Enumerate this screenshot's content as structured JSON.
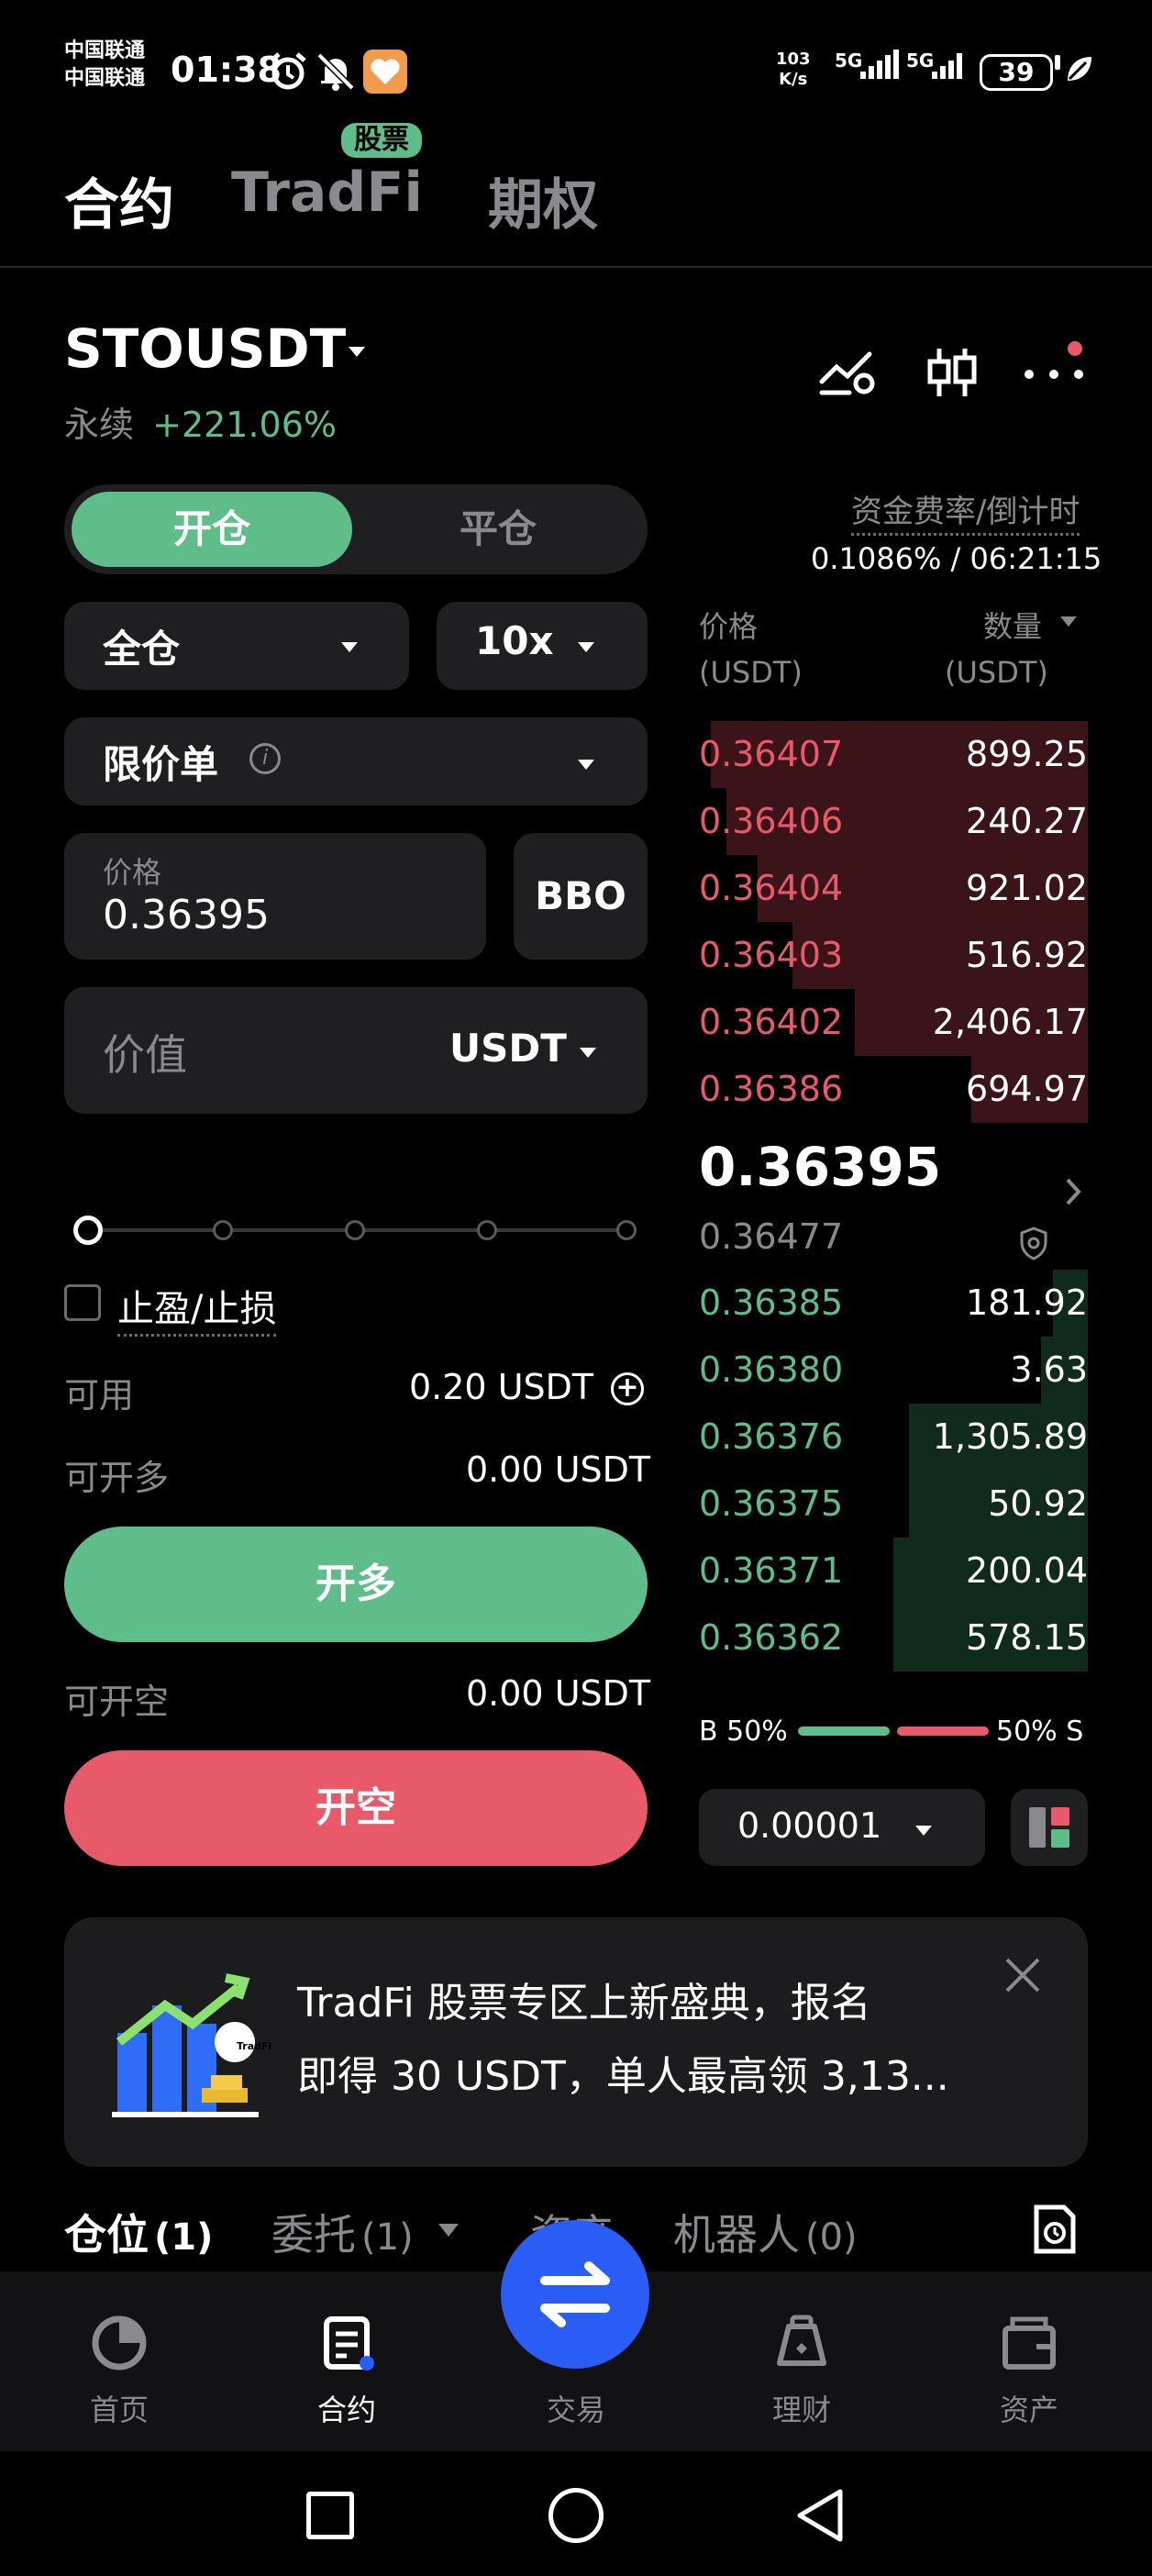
{
  "status_bar": {
    "carrier_line1": "中国联通",
    "carrier_line2": "中国联通",
    "time": "01:38",
    "net_speed_value": "103",
    "net_speed_unit": "K/s",
    "signal1": "5G",
    "signal2": "5G",
    "battery": "39"
  },
  "top_tabs": [
    {
      "label": "合约",
      "active": true
    },
    {
      "label": "TradFi",
      "active": false,
      "badge": "股票"
    },
    {
      "label": "期权",
      "active": false
    }
  ],
  "symbol": {
    "name": "STOUSDT",
    "type": "永续",
    "change": "+221.06%"
  },
  "order_form": {
    "open_label": "开仓",
    "close_label": "平仓",
    "margin_mode": "全仓",
    "leverage": "10x",
    "order_type": "限价单",
    "price_label": "价格",
    "price_value": "0.36395",
    "bbo_label": "BBO",
    "value_placeholder": "价值",
    "value_unit": "USDT",
    "tp_sl_label": "止盈/止损",
    "available_label": "可用",
    "available_value": "0.20 USDT",
    "can_long_label": "可开多",
    "can_long_value": "0.00 USDT",
    "long_button": "开多",
    "can_short_label": "可开空",
    "can_short_value": "0.00 USDT",
    "short_button": "开空",
    "slider_level": 0
  },
  "funding": {
    "label": "资金费率/倒计时",
    "value": "0.1086% / 06:21:15"
  },
  "orderbook": {
    "price_header": "价格",
    "price_unit": "(USDT)",
    "qty_header": "数量",
    "qty_unit": "(USDT)",
    "asks": [
      {
        "price": "0.36407",
        "qty": "899.25",
        "depth": 0.97
      },
      {
        "price": "0.36406",
        "qty": "240.27",
        "depth": 0.93
      },
      {
        "price": "0.36404",
        "qty": "921.02",
        "depth": 0.85
      },
      {
        "price": "0.36403",
        "qty": "516.92",
        "depth": 0.76
      },
      {
        "price": "0.36402",
        "qty": "2,406.17",
        "depth": 0.6
      },
      {
        "price": "0.36386",
        "qty": "694.97",
        "depth": 0.3
      }
    ],
    "last_price": "0.36395",
    "mark_price": "0.36477",
    "bids": [
      {
        "price": "0.36385",
        "qty": "181.92",
        "depth": 0.09
      },
      {
        "price": "0.36380",
        "qty": "3.63",
        "depth": 0.12
      },
      {
        "price": "0.36376",
        "qty": "1,305.89",
        "depth": 0.46
      },
      {
        "price": "0.36375",
        "qty": "50.92",
        "depth": 0.46
      },
      {
        "price": "0.36371",
        "qty": "200.04",
        "depth": 0.5
      },
      {
        "price": "0.36362",
        "qty": "578.15",
        "depth": 0.5
      }
    ],
    "buy_label": "B 50%",
    "sell_label": "50% S",
    "buy_ratio": 0.5,
    "precision": "0.00001"
  },
  "banner": {
    "line1": "TradFi 股票专区上新盛典，报名",
    "line2": "即得 30 USDT，单人最高领 3,13...",
    "logo_text": "TradFi"
  },
  "position_tabs": [
    {
      "label": "仓位",
      "count": "(1)"
    },
    {
      "label": "委托",
      "count": "(1)"
    },
    {
      "label": "资产",
      "count": ""
    },
    {
      "label": "机器人",
      "count": "(0)"
    }
  ],
  "bottom_nav": [
    {
      "label": "首页"
    },
    {
      "label": "合约"
    },
    {
      "label": "交易"
    },
    {
      "label": "理财"
    },
    {
      "label": "资产"
    }
  ],
  "colors": {
    "up": "#5fbd8a",
    "down": "#e8596a",
    "trade_button": "#2a5cf6"
  }
}
